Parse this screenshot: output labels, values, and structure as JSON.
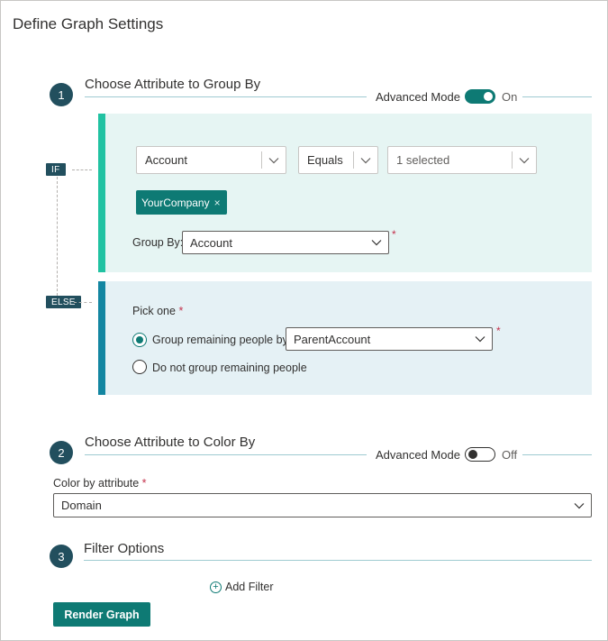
{
  "page": {
    "title": "Define Graph Settings"
  },
  "step1": {
    "number": "1",
    "title": "Choose Attribute to Group By",
    "advanced_mode_label": "Advanced Mode",
    "advanced_mode_state": "On",
    "if_tag": "IF",
    "else_tag": "ELSE",
    "attribute_dropdown": "Account",
    "operator_dropdown": "Equals",
    "values_dropdown": "1 selected",
    "selected_value_pill": "YourCompany",
    "pill_remove_glyph": "×",
    "group_by_label": "Group By:",
    "group_by_value": "Account",
    "required_mark": "*",
    "pick_one_label": "Pick one",
    "option_group_label": "Group remaining people by:",
    "option_group_value": "ParentAccount",
    "option_no_group_label": "Do not group remaining people"
  },
  "step2": {
    "number": "2",
    "title": "Choose Attribute to Color By",
    "advanced_mode_label": "Advanced Mode",
    "advanced_mode_state": "Off",
    "color_by_label": "Color by attribute",
    "required_mark": "*",
    "color_by_value": "Domain"
  },
  "step3": {
    "number": "3",
    "title": "Filter Options",
    "add_filter_label": "Add Filter",
    "add_filter_glyph": "+"
  },
  "actions": {
    "render_label": "Render Graph"
  },
  "colors": {
    "accent": "#0e7a74",
    "step_circle": "#224f5e",
    "if_bar": "#21c2a2",
    "else_bar": "#1386a1",
    "required": "#c4314b"
  },
  "icons": {
    "dropdown": "chevron-down-icon",
    "add": "plus-circle-icon",
    "remove": "close-icon"
  }
}
